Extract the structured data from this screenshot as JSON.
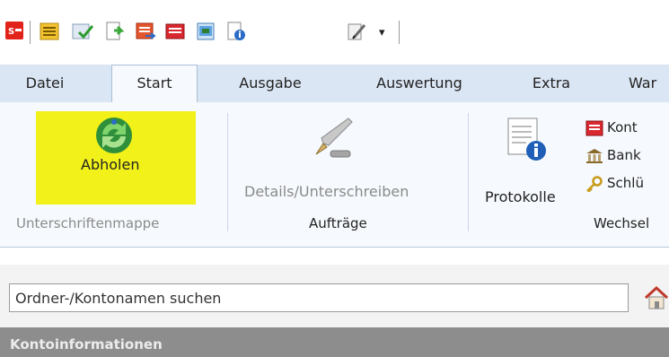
{
  "quick_access": {
    "app_logo_text": "S",
    "items": [
      "folder-list-icon",
      "approve-icon",
      "send-document-icon",
      "transfer-icon",
      "account-red-icon",
      "calendar-icon",
      "document-info-icon",
      "sign-pen-icon"
    ],
    "dropdown_glyph": "▾"
  },
  "tabs": [
    {
      "label": "Datei"
    },
    {
      "label": "Start"
    },
    {
      "label": "Ausgabe"
    },
    {
      "label": "Auswertung"
    },
    {
      "label": "Extra"
    },
    {
      "label": "War"
    }
  ],
  "ribbon": {
    "buttons": {
      "abholen": "Abholen",
      "details": "Details/Unterschreiben",
      "protokolle": "Protokolle"
    },
    "small_buttons": [
      "Kont",
      "Bank",
      "Schlü"
    ],
    "groups": {
      "unterschriftenmappe": "Unterschriftenmappe",
      "auftraege": "Aufträge",
      "wechsel": "Wechsel"
    }
  },
  "search": {
    "value": "",
    "placeholder": "Ordner-/Kontonamen suchen"
  },
  "info_header": {
    "title": "Kontoinformationen"
  },
  "colors": {
    "highlight": "#f2f21a",
    "tabbar": "#dbe6f4",
    "ribbon": "#f6f9fd",
    "infobar": "#8d8d8d"
  }
}
